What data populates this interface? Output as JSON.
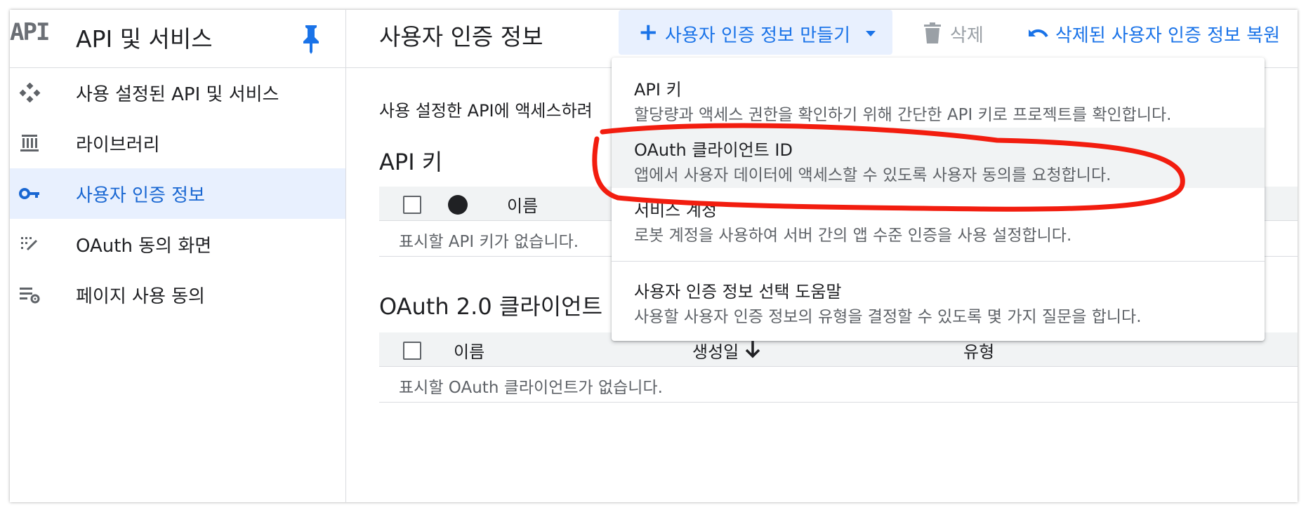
{
  "sidebar": {
    "logo": "API",
    "title": "API 및 서비스",
    "items": [
      {
        "label": "사용 설정된 API 및 서비스",
        "icon": "api-diamond-icon"
      },
      {
        "label": "라이브러리",
        "icon": "library-icon"
      },
      {
        "label": "사용자 인증 정보",
        "icon": "key-icon",
        "active": true
      },
      {
        "label": "OAuth 동의 화면",
        "icon": "consent-screen-icon"
      },
      {
        "label": "페이지 사용 동의",
        "icon": "page-settings-icon"
      }
    ]
  },
  "topbar": {
    "title": "사용자 인증 정보",
    "create_label": "사용자 인증 정보 만들기",
    "delete_label": "삭제",
    "restore_label": "삭제된 사용자 인증 정보 복원"
  },
  "main": {
    "intro": "사용 설정한 API에 액세스하려",
    "api_keys": {
      "title": "API 키",
      "col_name": "이름",
      "empty": "표시할 API 키가 없습니다."
    },
    "oauth": {
      "title": "OAuth 2.0 클라이언트",
      "col_name": "이름",
      "col_created": "생성일",
      "col_type": "유형",
      "empty": "표시할 OAuth 클라이언트가 없습니다."
    }
  },
  "menu": {
    "items": [
      {
        "title": "API 키",
        "desc": "할당량과 액세스 권한을 확인하기 위해 간단한 API 키로 프로젝트를 확인합니다."
      },
      {
        "title": "OAuth 클라이언트 ID",
        "desc": "앱에서 사용자 데이터에 액세스할 수 있도록 사용자 동의를 요청합니다."
      },
      {
        "title": "서비스 계정",
        "desc": "로봇 계정을 사용하여 서버 간의 앱 수준 인증을 사용 설정합니다."
      },
      {
        "title": "사용자 인증 정보 선택 도움말",
        "desc": "사용할 사용자 인증 정보의 유형을 결정할 수 있도록 몇 가지 질문을 합니다."
      }
    ]
  },
  "colors": {
    "accent": "#1a73e8",
    "active_bg": "#e8f0fe",
    "annotation": "#f21d0f"
  }
}
